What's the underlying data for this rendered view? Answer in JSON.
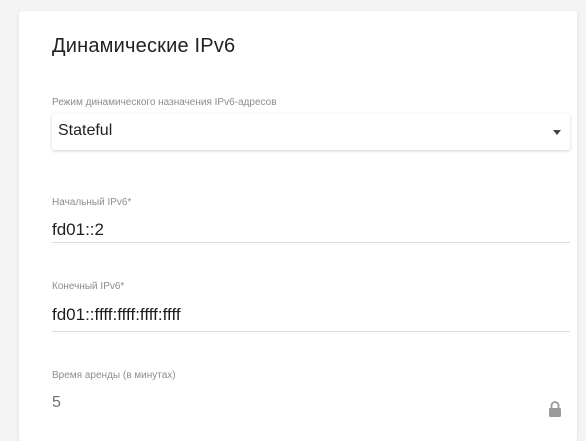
{
  "section": {
    "title": "Динамические IPv6"
  },
  "mode_field": {
    "label": "Режим динамического назначения IPv6-адресов",
    "value": "Stateful"
  },
  "start_field": {
    "label": "Начальный IPv6*",
    "value": "fd01::2"
  },
  "end_field": {
    "label": "Конечный IPv6*",
    "value": "fd01::ffff:ffff:ffff:ffff"
  },
  "lease_field": {
    "label": "Время аренды (в минутах)",
    "value": "5",
    "icon": "lock-icon"
  },
  "colors": {
    "background": "#f3f3f3",
    "card": "#ffffff",
    "text": "#1f1f1f",
    "label": "#8c8c8c",
    "disabled_text": "#6f6f6f"
  }
}
